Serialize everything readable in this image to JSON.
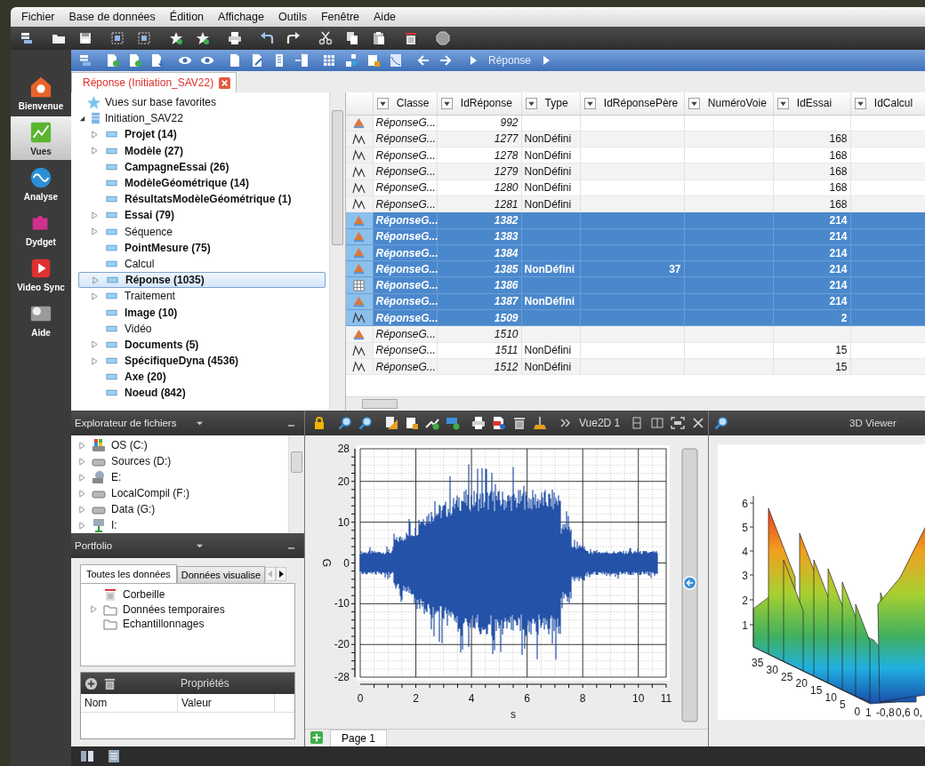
{
  "menu": [
    "Fichier",
    "Base de données",
    "Édition",
    "Affichage",
    "Outils",
    "Fenêtre",
    "Aide"
  ],
  "sidebar": [
    {
      "label": "Bienvenue",
      "selected": false
    },
    {
      "label": "Vues",
      "selected": true
    },
    {
      "label": "Analyse",
      "selected": false
    },
    {
      "label": "Dydget",
      "selected": false
    },
    {
      "label": "Video Sync",
      "selected": false
    },
    {
      "label": "Aide",
      "selected": false
    }
  ],
  "breadcrumb": "Réponse",
  "document_tab": {
    "label": "Réponse (Initiation_SAV22)"
  },
  "tree": {
    "favorites": "Vues sur base favorites",
    "root": {
      "label": "Initiation_SAV22",
      "expanded": true,
      "children": [
        {
          "label": "Projet (14)",
          "bold": true,
          "expandable": true,
          "selected": false
        },
        {
          "label": "Modèle (27)",
          "bold": true,
          "expandable": true,
          "selected": false
        },
        {
          "label": "CampagneEssai (26)",
          "bold": true,
          "expandable": false,
          "selected": false
        },
        {
          "label": "ModèleGéométrique (14)",
          "bold": true,
          "expandable": false,
          "selected": false
        },
        {
          "label": "RésultatsModèleGéométrique (1)",
          "bold": true,
          "expandable": false,
          "selected": false
        },
        {
          "label": "Essai (79)",
          "bold": true,
          "expandable": true,
          "selected": false
        },
        {
          "label": "Séquence",
          "bold": false,
          "expandable": true,
          "selected": false
        },
        {
          "label": "PointMesure (75)",
          "bold": true,
          "expandable": false,
          "selected": false
        },
        {
          "label": "Calcul",
          "bold": false,
          "expandable": false,
          "selected": false
        },
        {
          "label": "Réponse (1035)",
          "bold": true,
          "expandable": true,
          "selected": true
        },
        {
          "label": "Traitement",
          "bold": false,
          "expandable": true,
          "selected": false
        },
        {
          "label": "Image (10)",
          "bold": true,
          "expandable": false,
          "selected": false
        },
        {
          "label": "Vidéo",
          "bold": false,
          "expandable": false,
          "selected": false
        },
        {
          "label": "Documents (5)",
          "bold": true,
          "expandable": true,
          "selected": false
        },
        {
          "label": "SpécifiqueDyna (4536)",
          "bold": true,
          "expandable": true,
          "selected": false
        },
        {
          "label": "Axe (20)",
          "bold": true,
          "expandable": false,
          "selected": false
        },
        {
          "label": "Noeud (842)",
          "bold": true,
          "expandable": false,
          "selected": false
        }
      ]
    }
  },
  "table": {
    "columns": [
      "Classe",
      "IdRéponse",
      "Type",
      "IdRéponsePère",
      "NuméroVoie",
      "IdEssai",
      "IdCalcul"
    ],
    "rows": [
      {
        "kind": "cone",
        "selected": false,
        "classe": "RéponseG...",
        "id_reponse": "992"
      },
      {
        "kind": "curve",
        "selected": false,
        "classe": "RéponseG...",
        "id_reponse": "1277",
        "type": "NonDéfini",
        "id_essai": "168"
      },
      {
        "kind": "curve",
        "selected": false,
        "classe": "RéponseG...",
        "id_reponse": "1278",
        "type": "NonDéfini",
        "id_essai": "168"
      },
      {
        "kind": "curve",
        "selected": false,
        "classe": "RéponseG...",
        "id_reponse": "1279",
        "type": "NonDéfini",
        "id_essai": "168"
      },
      {
        "kind": "curve",
        "selected": false,
        "classe": "RéponseG...",
        "id_reponse": "1280",
        "type": "NonDéfini",
        "id_essai": "168"
      },
      {
        "kind": "curve",
        "selected": false,
        "classe": "RéponseG...",
        "id_reponse": "1281",
        "type": "NonDéfini",
        "id_essai": "168"
      },
      {
        "kind": "cone",
        "selected": true,
        "classe": "RéponseG...",
        "id_reponse": "1382",
        "id_essai": "214"
      },
      {
        "kind": "cone",
        "selected": true,
        "classe": "RéponseG...",
        "id_reponse": "1383",
        "id_essai": "214"
      },
      {
        "kind": "cone",
        "selected": true,
        "classe": "RéponseG...",
        "id_reponse": "1384",
        "id_essai": "214"
      },
      {
        "kind": "cone",
        "selected": true,
        "classe": "RéponseG...",
        "id_reponse": "1385",
        "type": "NonDéfini",
        "id_reponse_pere": "37",
        "id_essai": "214"
      },
      {
        "kind": "grid",
        "selected": true,
        "classe": "RéponseG...",
        "id_reponse": "1386",
        "id_essai": "214"
      },
      {
        "kind": "cone",
        "selected": true,
        "classe": "RéponseG...",
        "id_reponse": "1387",
        "type": "NonDéfini",
        "id_essai": "214"
      },
      {
        "kind": "curve",
        "selected": true,
        "classe": "RéponseG...",
        "id_reponse": "1509",
        "id_essai": "2"
      },
      {
        "kind": "cone",
        "selected": false,
        "classe": "RéponseG...",
        "id_reponse": "1510"
      },
      {
        "kind": "curve",
        "selected": false,
        "classe": "RéponseG...",
        "id_reponse": "1511",
        "type": "NonDéfini",
        "id_essai": "15"
      },
      {
        "kind": "curve",
        "selected": false,
        "classe": "RéponseG...",
        "id_reponse": "1512",
        "type": "NonDéfini",
        "id_essai": "15"
      }
    ]
  },
  "file_explorer": {
    "title": "Explorateur de fichiers",
    "drives": [
      {
        "label": "OS (C:)",
        "kind": "system"
      },
      {
        "label": "Sources (D:)",
        "kind": "disk"
      },
      {
        "label": "E:",
        "kind": "network"
      },
      {
        "label": "LocalCompil (F:)",
        "kind": "disk"
      },
      {
        "label": "Data (G:)",
        "kind": "disk"
      },
      {
        "label": "I:",
        "kind": "share"
      }
    ]
  },
  "portfolio": {
    "title": "Portfolio",
    "tabs": [
      {
        "label": "Toutes les données",
        "selected": true
      },
      {
        "label": "Données visualise",
        "selected": false
      }
    ],
    "items": [
      {
        "label": "Corbeille",
        "kind": "trash",
        "expandable": false
      },
      {
        "label": "Données temporaires",
        "kind": "folder",
        "expandable": true
      },
      {
        "label": "Echantillonnages",
        "kind": "folder",
        "expandable": false
      }
    ]
  },
  "properties": {
    "title": "Propriétés",
    "columns": [
      "Nom",
      "Valeur"
    ]
  },
  "plot": {
    "view_title": "Vue2D 1",
    "ylabel": "G",
    "xlabel": "s",
    "yticks": [
      "28",
      "20",
      "10",
      "0",
      "-10",
      "-20",
      "-28"
    ],
    "xticks": [
      "0",
      "2",
      "4",
      "6",
      "8",
      "10",
      "11"
    ],
    "page_tab": "Page 1"
  },
  "viewer_3d": {
    "title": "3D Viewer",
    "z_ticks": [
      "6",
      "5",
      "4",
      "3",
      "2",
      "1"
    ],
    "y_ticks": [
      "35",
      "30",
      "25",
      "20",
      "15",
      "10",
      "5",
      "0"
    ],
    "x_ticks": [
      "1",
      "-0,8",
      "0,6",
      "0,"
    ]
  }
}
